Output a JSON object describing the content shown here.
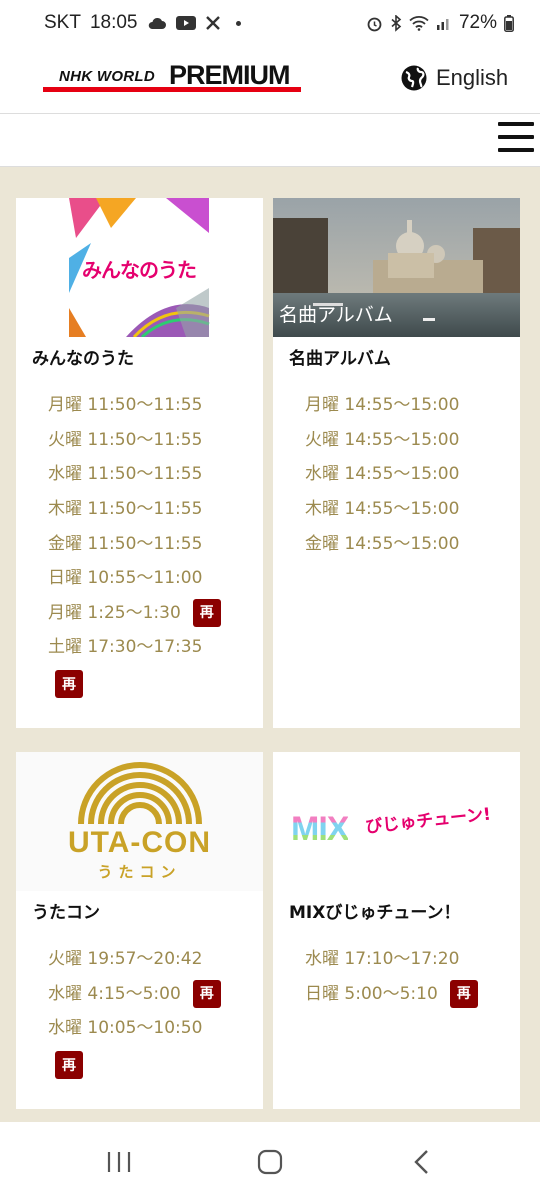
{
  "status": {
    "carrier": "SKT",
    "time": "18:05",
    "battery": "72%"
  },
  "header": {
    "logo_prefix": "NHK WORLD",
    "logo_main": "PREMIUM",
    "language": "English"
  },
  "badge_label": "再",
  "cards": [
    {
      "title": "みんなのうた",
      "thumb_text": "みんなのうた",
      "schedule": [
        {
          "time": "月曜 11:50〜11:55"
        },
        {
          "time": "火曜 11:50〜11:55"
        },
        {
          "time": "水曜 11:50〜11:55"
        },
        {
          "time": "木曜 11:50〜11:55"
        },
        {
          "time": "金曜 11:50〜11:55"
        },
        {
          "time": "日曜 10:55〜11:00"
        },
        {
          "time": "月曜 1:25〜1:30"
        },
        {
          "time": "土曜 17:30〜17:35"
        }
      ]
    },
    {
      "title": "名曲アルバム",
      "thumb_text": "名曲アルバム",
      "schedule": [
        {
          "time": "月曜 14:55〜15:00"
        },
        {
          "time": "火曜 14:55〜15:00"
        },
        {
          "time": "水曜 14:55〜15:00"
        },
        {
          "time": "木曜 14:55〜15:00"
        },
        {
          "time": "金曜 14:55〜15:00"
        }
      ]
    },
    {
      "title": "うたコン",
      "thumb_text": "UTA-CON",
      "thumb_subtext": "うたコン",
      "schedule": [
        {
          "time": "火曜 19:57〜20:42"
        },
        {
          "time": "水曜 4:15〜5:00"
        },
        {
          "time": "水曜 10:05〜10:50"
        }
      ]
    },
    {
      "title": "MIXびじゅチューン！",
      "thumb_text": "MIX",
      "thumb_subtext": "びじゅチューン!",
      "schedule": [
        {
          "time": "水曜 17:10〜17:20"
        },
        {
          "time": "日曜 5:00〜5:10"
        }
      ]
    }
  ],
  "colors": {
    "accent_red": "#e60012",
    "badge": "#8b0000",
    "schedule_text": "#9c8a4f",
    "page_bg": "#ebe6d6"
  }
}
